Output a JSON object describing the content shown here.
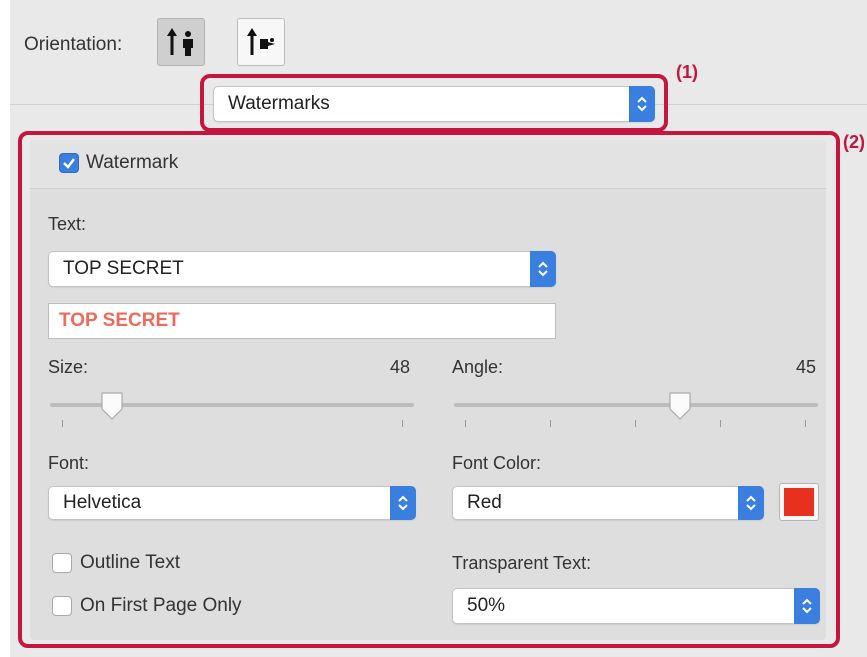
{
  "orientation": {
    "label": "Orientation:",
    "portrait_icon": "portrait-orientation-icon",
    "landscape_icon": "landscape-orientation-icon",
    "selected": "portrait"
  },
  "annotations": {
    "label_1": "(1)",
    "label_2": "(2)",
    "color": "#c4163f"
  },
  "section_popup": {
    "value": "Watermarks"
  },
  "watermark": {
    "enabled": true,
    "checkbox_label": "Watermark",
    "text_label": "Text:",
    "text_popup_value": "TOP SECRET",
    "text_field_value": "TOP SECRET",
    "size_label": "Size:",
    "size_value": "48",
    "size_slider_fraction": 0.17,
    "angle_label": "Angle:",
    "angle_value": "45",
    "angle_slider_fraction": 0.62,
    "font_label": "Font:",
    "font_value": "Helvetica",
    "font_color_label": "Font Color:",
    "font_color_value": "Red",
    "font_color_swatch": "#e8301f",
    "outline_text_label": "Outline Text",
    "outline_text_checked": false,
    "first_page_only_label": "On First Page Only",
    "first_page_only_checked": false,
    "transparent_text_label": "Transparent Text:",
    "transparent_text_value": "50%"
  },
  "colors": {
    "accent": "#3a7fe0",
    "highlight": "#c4163f",
    "preview_text": "#f06a5a"
  }
}
